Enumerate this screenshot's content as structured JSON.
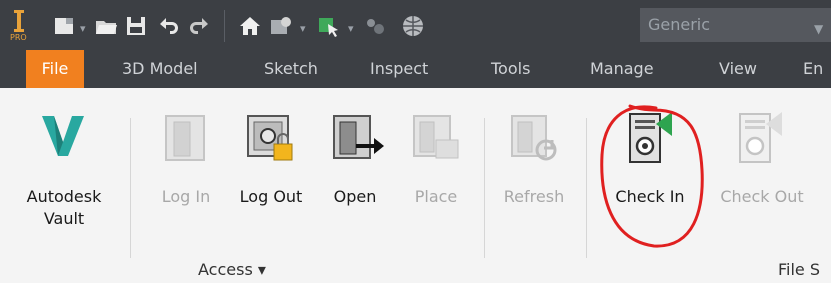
{
  "qat": {
    "logo_text": "PRO",
    "combo_value": "Generic",
    "icons": [
      "new-icon",
      "open-folder-icon",
      "save-icon",
      "undo-icon",
      "redo-icon",
      "home-icon",
      "appearance-icon",
      "select-icon",
      "material-icon",
      "globe-icon"
    ]
  },
  "tabs": [
    {
      "label": "File"
    },
    {
      "label": "3D Model"
    },
    {
      "label": "Sketch"
    },
    {
      "label": "Inspect"
    },
    {
      "label": "Tools"
    },
    {
      "label": "Manage"
    },
    {
      "label": "View"
    },
    {
      "label": "En"
    }
  ],
  "ribbon": {
    "buttons": [
      {
        "id": "autodesk-vault",
        "label_line1": "Autodesk",
        "label_line2": "Vault",
        "enabled": true
      },
      {
        "id": "log-in",
        "label": "Log In",
        "enabled": false
      },
      {
        "id": "log-out",
        "label": "Log Out",
        "enabled": true
      },
      {
        "id": "open",
        "label": "Open",
        "enabled": true
      },
      {
        "id": "place",
        "label": "Place",
        "enabled": false
      },
      {
        "id": "refresh",
        "label": "Refresh",
        "enabled": false
      },
      {
        "id": "check-in",
        "label": "Check In",
        "enabled": true
      },
      {
        "id": "check-out",
        "label": "Check Out",
        "enabled": false
      }
    ],
    "groups": [
      {
        "label": "Access ▾"
      },
      {
        "label": "File S"
      }
    ]
  },
  "colors": {
    "dark_bg": "#3c3f44",
    "file_tab": "#f1801f",
    "vault_teal": "#29a8a0",
    "annotation_red": "#e02020"
  }
}
